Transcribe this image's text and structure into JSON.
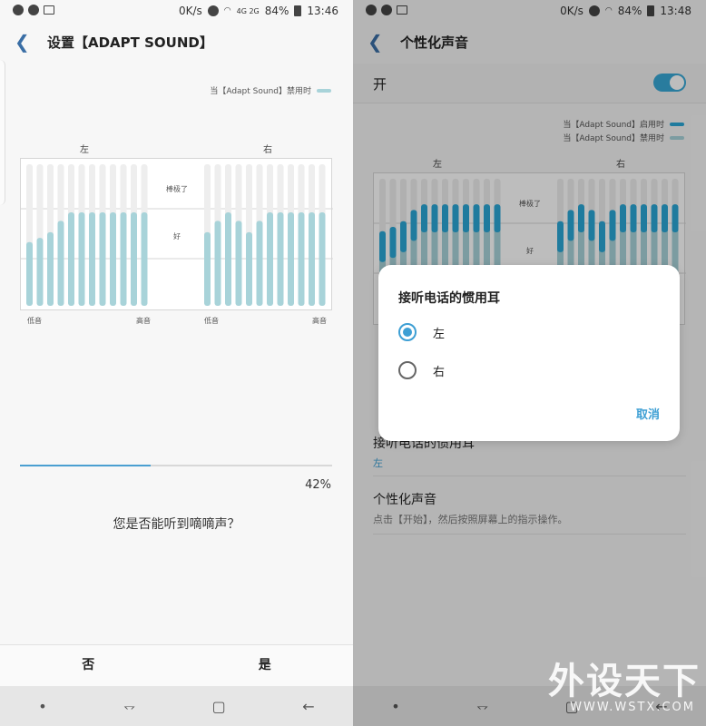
{
  "left": {
    "status": {
      "network": "0K/s",
      "sim": "4G 2G",
      "battery": "84%",
      "time": "13:46"
    },
    "appbar": {
      "title": "设置【ADAPT SOUND】"
    },
    "legend": {
      "disabled": "当【Adapt Sound】禁用时"
    },
    "chart": {
      "left_title": "左",
      "right_title": "右",
      "mid_top": "棒极了",
      "mid_bottom": "好",
      "low": "低音",
      "high": "高音",
      "left_values": [
        0.45,
        0.48,
        0.52,
        0.6,
        0.66,
        0.66,
        0.66,
        0.66,
        0.66,
        0.66,
        0.66,
        0.66
      ],
      "right_values": [
        0.52,
        0.6,
        0.66,
        0.6,
        0.52,
        0.6,
        0.66,
        0.66,
        0.66,
        0.66,
        0.66,
        0.66
      ]
    },
    "progress": {
      "value": 0.42,
      "label": "42%"
    },
    "question": "您是否能听到嘀嘀声？",
    "actions": {
      "no": "否",
      "yes": "是"
    }
  },
  "right": {
    "status": {
      "network": "0K/s",
      "battery": "84%",
      "time": "13:48"
    },
    "appbar": {
      "title": "个性化声音"
    },
    "open_label": "开",
    "legend": {
      "enabled": "当【Adapt Sound】启用时",
      "disabled": "当【Adapt Sound】禁用时"
    },
    "chart": {
      "left_title": "左",
      "right_title": "右",
      "mid_top": "棒极了",
      "mid_bottom": "好"
    },
    "setting_ear": {
      "title": "接听电话的惯用耳",
      "value": "左"
    },
    "setting_personal": {
      "title": "个性化声音",
      "desc": "点击【开始】，然后按照屏幕上的指示操作。"
    },
    "dialog": {
      "title": "接听电话的惯用耳",
      "options": [
        "左",
        "右"
      ],
      "selected": "左",
      "cancel": "取消"
    },
    "watermark": {
      "text": "外设天下",
      "url": "WWW.WSTX.COM"
    }
  },
  "colors": {
    "accent": "#3d9fd4",
    "bar_disabled": "#a8d3d9",
    "bar_enabled": "#2aa7d6",
    "track": "#eeeeee"
  }
}
